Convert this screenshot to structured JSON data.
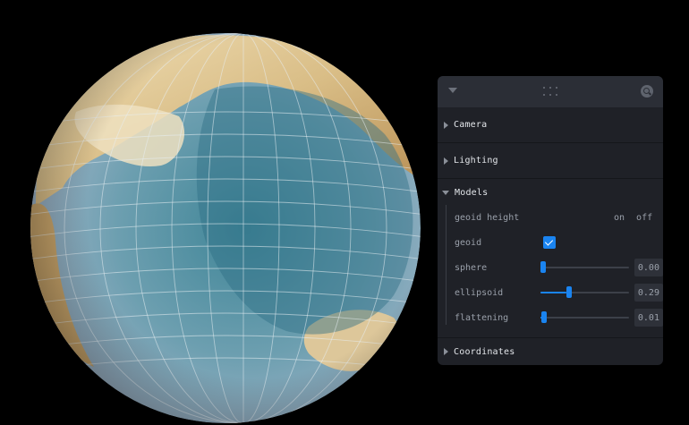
{
  "panel": {
    "folders": [
      {
        "title": "Camera",
        "expanded": false
      },
      {
        "title": "Lighting",
        "expanded": false
      },
      {
        "title": "Models",
        "expanded": true
      },
      {
        "title": "Coordinates",
        "expanded": false
      }
    ],
    "models": {
      "geoid_height": {
        "label": "geoid height",
        "on": "on",
        "off": "off"
      },
      "geoid": {
        "label": "geoid",
        "checked": true
      },
      "sphere": {
        "label": "sphere",
        "value": "0.00",
        "level": 0.0
      },
      "ellipsoid": {
        "label": "ellipsoid",
        "value": "0.29",
        "level": 0.29
      },
      "flattening": {
        "label": "flattening",
        "value": "0.01",
        "level": 0.01
      }
    }
  },
  "colors": {
    "accent": "#1a84f0",
    "panel_bg": "#1f2127",
    "panel_header": "#2b2e36",
    "ocean": "#4f8f9e",
    "land": "#d8bf8a",
    "grid": "#e8eef2"
  },
  "icons": [
    "collapse-triangle-icon",
    "drag-grip-icon",
    "search-icon",
    "folder-arrow-icon",
    "checkmark-icon"
  ]
}
